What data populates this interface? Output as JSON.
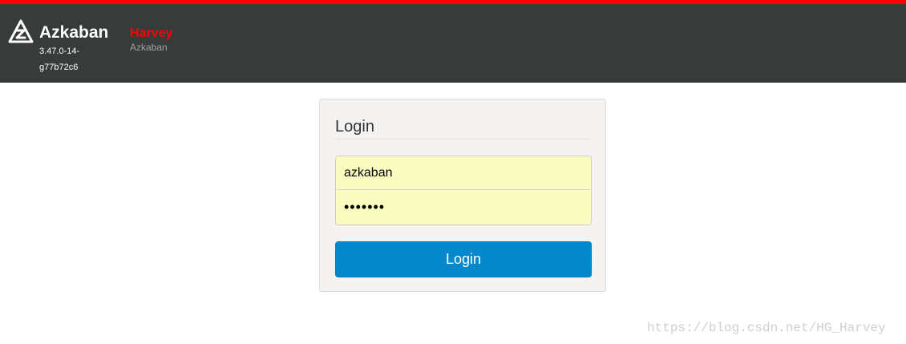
{
  "colors": {
    "accent": "#ff0000",
    "navbar": "#373b3a",
    "button": "#0488cc",
    "input_fill": "#fafdbf"
  },
  "header": {
    "logo_icon": "azkaban-logo-icon",
    "brand": "Azkaban",
    "version": "3.47.0-14-g77b72c6",
    "env_name": "Harvey",
    "env_desc": "Azkaban"
  },
  "login": {
    "title": "Login",
    "username_value": "azkaban",
    "password_value": "azkaban",
    "button_label": "Login"
  },
  "watermark": "https://blog.csdn.net/HG_Harvey"
}
